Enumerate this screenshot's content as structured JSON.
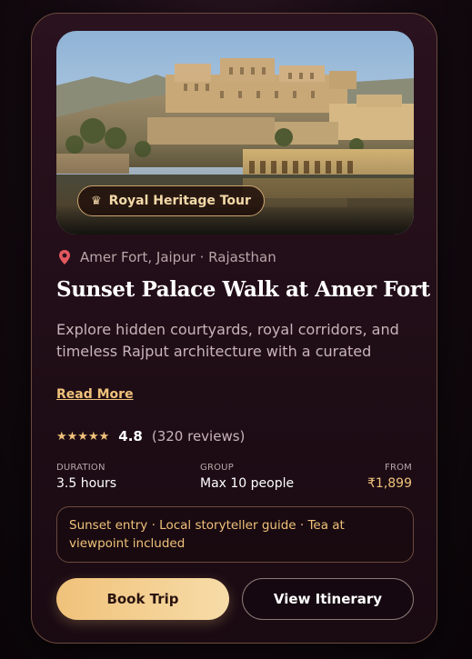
{
  "card": {
    "badge": {
      "icon": "crown-icon",
      "label": "Royal Heritage Tour"
    },
    "location": {
      "icon": "pin-icon",
      "text": "Amer Fort, Jaipur · Rajasthan"
    },
    "title": "Sunset Palace Walk at Amer Fort",
    "description": "Explore hidden courtyards, royal corridors, and timeless Rajput architecture with a curated",
    "read_more": "Read More",
    "rating": {
      "stars": "★★★★★",
      "score": "4.8",
      "reviews": "(320 reviews)"
    },
    "meta": {
      "duration": {
        "label": "DURATION",
        "value": "3.5 hours"
      },
      "group": {
        "label": "GROUP",
        "value": "Max 10 people"
      },
      "from": {
        "label": "FROM",
        "value": "₹1,899"
      }
    },
    "note": "Sunset entry · Local storyteller guide · Tea at viewpoint included",
    "buttons": {
      "primary": "Book Trip",
      "secondary": "View Itinerary"
    }
  },
  "colors": {
    "accent": "#f0c27a",
    "background": "#1f0d16",
    "border": "#6b4a3e",
    "text": "#ffffff",
    "muted": "#c9b4b9"
  }
}
